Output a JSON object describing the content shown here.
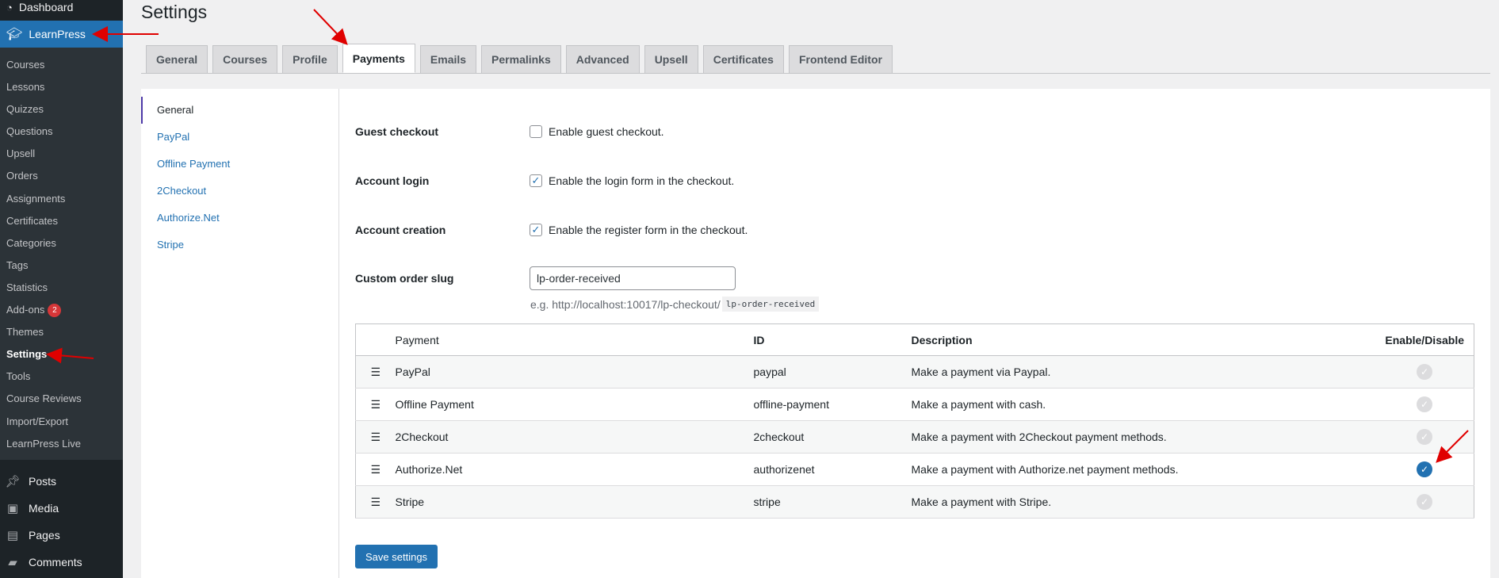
{
  "sidebar": {
    "dashboard": "Dashboard",
    "learnpress": "LearnPress",
    "submenu": [
      {
        "label": "Courses"
      },
      {
        "label": "Lessons"
      },
      {
        "label": "Quizzes"
      },
      {
        "label": "Questions"
      },
      {
        "label": "Upsell"
      },
      {
        "label": "Orders"
      },
      {
        "label": "Assignments"
      },
      {
        "label": "Certificates"
      },
      {
        "label": "Categories"
      },
      {
        "label": "Tags"
      },
      {
        "label": "Statistics"
      },
      {
        "label": "Add-ons",
        "badge": "2"
      },
      {
        "label": "Themes"
      },
      {
        "label": "Settings"
      },
      {
        "label": "Tools"
      },
      {
        "label": "Course Reviews"
      },
      {
        "label": "Import/Export"
      },
      {
        "label": "LearnPress Live"
      }
    ],
    "bottom": [
      {
        "label": "Posts",
        "icon": "pin-icon"
      },
      {
        "label": "Media",
        "icon": "media-icon"
      },
      {
        "label": "Pages",
        "icon": "pages-icon"
      },
      {
        "label": "Comments",
        "icon": "comments-icon"
      }
    ]
  },
  "page": {
    "title": "Settings"
  },
  "tabs": [
    {
      "label": "General"
    },
    {
      "label": "Courses"
    },
    {
      "label": "Profile"
    },
    {
      "label": "Payments",
      "active": true
    },
    {
      "label": "Emails"
    },
    {
      "label": "Permalinks"
    },
    {
      "label": "Advanced"
    },
    {
      "label": "Upsell"
    },
    {
      "label": "Certificates"
    },
    {
      "label": "Frontend Editor"
    }
  ],
  "subnav": [
    {
      "label": "General"
    },
    {
      "label": "PayPal"
    },
    {
      "label": "Offline Payment"
    },
    {
      "label": "2Checkout"
    },
    {
      "label": "Authorize.Net"
    },
    {
      "label": "Stripe"
    }
  ],
  "form": {
    "guest_checkout": {
      "label": "Guest checkout",
      "text": "Enable guest checkout.",
      "checked": false
    },
    "account_login": {
      "label": "Account login",
      "text": "Enable the login form in the checkout.",
      "checked": true
    },
    "account_creation": {
      "label": "Account creation",
      "text": "Enable the register form in the checkout.",
      "checked": true
    },
    "custom_slug": {
      "label": "Custom order slug",
      "value": "lp-order-received",
      "desc_prefix": "e.g. http://localhost:10017/lp-checkout/",
      "desc_code": "lp-order-received"
    }
  },
  "table": {
    "headers": {
      "payment": "Payment",
      "id": "ID",
      "description": "Description",
      "enable": "Enable/Disable"
    },
    "rows": [
      {
        "name": "PayPal",
        "id": "paypal",
        "description": "Make a payment via Paypal.",
        "enabled": false
      },
      {
        "name": "Offline Payment",
        "id": "offline-payment",
        "description": "Make a payment with cash.",
        "enabled": false
      },
      {
        "name": "2Checkout",
        "id": "2checkout",
        "description": "Make a payment with 2Checkout payment methods.",
        "enabled": false
      },
      {
        "name": "Authorize.Net",
        "id": "authorizenet",
        "description": "Make a payment with Authorize.net payment methods.",
        "enabled": true
      },
      {
        "name": "Stripe",
        "id": "stripe",
        "description": "Make a payment with Stripe.",
        "enabled": false
      }
    ]
  },
  "save_label": "Save settings",
  "colors": {
    "accent": "#2271b1",
    "sidebar": "#1d2327",
    "arrow": "#e00000"
  }
}
